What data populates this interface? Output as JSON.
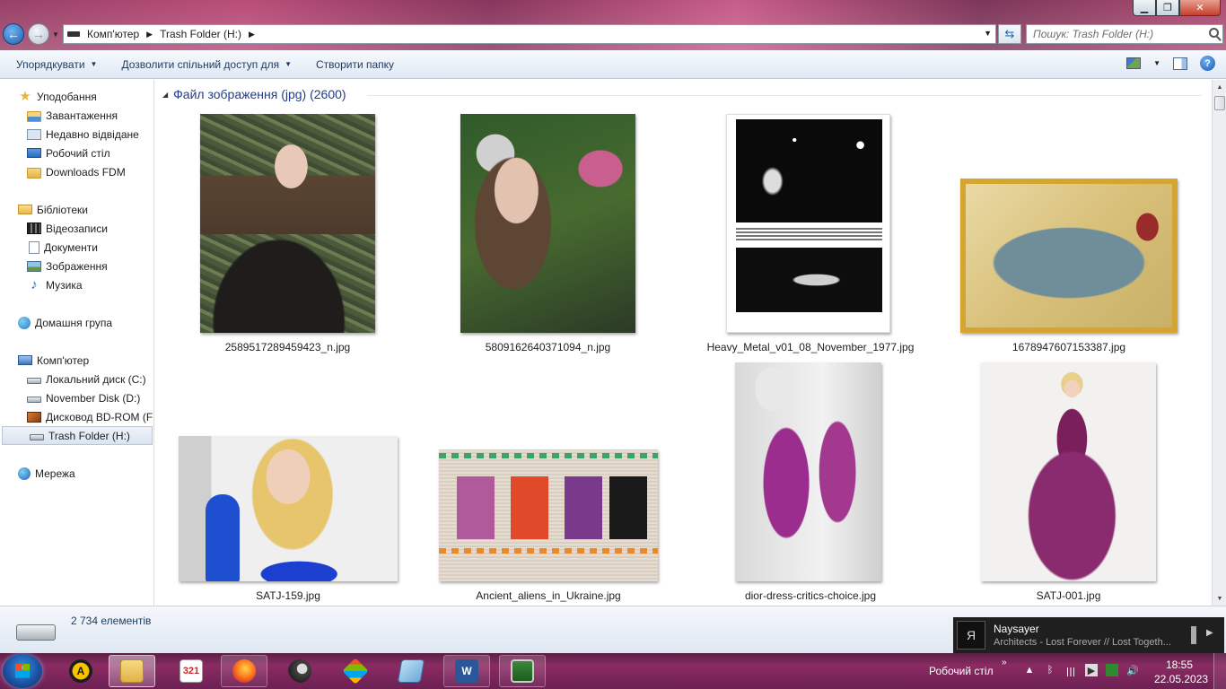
{
  "window": {
    "controls": {
      "minimize": "▁",
      "maximize": "❐",
      "close": "✕"
    }
  },
  "address": {
    "crumbs": [
      "Комп'ютер",
      "Trash Folder (H:)"
    ],
    "search_placeholder": "Пошук: Trash Folder (H:)"
  },
  "toolbar": {
    "organize": "Упорядкувати",
    "share": "Дозволити спільний доступ для",
    "new_folder": "Створити папку"
  },
  "sidebar": {
    "favorites": "Уподобання",
    "downloads": "Завантаження",
    "recent": "Недавно відвідане",
    "desktop": "Робочий стіл",
    "downloads_fdm": "Downloads FDM",
    "libraries": "Бібліотеки",
    "videos": "Відеозаписи",
    "documents": "Документи",
    "pictures": "Зображення",
    "music": "Музика",
    "homegroup": "Домашня група",
    "computer": "Комп'ютер",
    "drive_c": "Локальний диск (C:)",
    "drive_d": "November Disk (D:)",
    "drive_bd": "Дисковод BD-ROM (F:)",
    "drive_h": "Trash Folder (H:)",
    "network": "Мережа"
  },
  "content": {
    "group_header": "Файл зображення (jpg) (2600)",
    "files": [
      "2589517289459423_n.jpg",
      "5809162640371094_n.jpg",
      "Heavy_Metal_v01_08_November_1977.jpg",
      "1678947607153387.jpg",
      "SATJ-159.jpg",
      "Ancient_aliens_in_Ukraine.jpg",
      "dior-dress-critics-choice.jpg",
      "SATJ-001.jpg"
    ]
  },
  "details": {
    "item_count": "2 734 елементів"
  },
  "notification": {
    "artist": "Naysayer",
    "track": "Architects - Lost Forever // Lost Togeth...",
    "art_glyph": "Я"
  },
  "taskbar": {
    "tray_label": "Робочий стіл",
    "chevron": "»",
    "time": "18:55",
    "date": "22.05.2023",
    "app_321": "321",
    "app_word": "W"
  },
  "colors": {
    "accent_link": "#1e3d8f",
    "taskbar": "#8b2b63"
  }
}
